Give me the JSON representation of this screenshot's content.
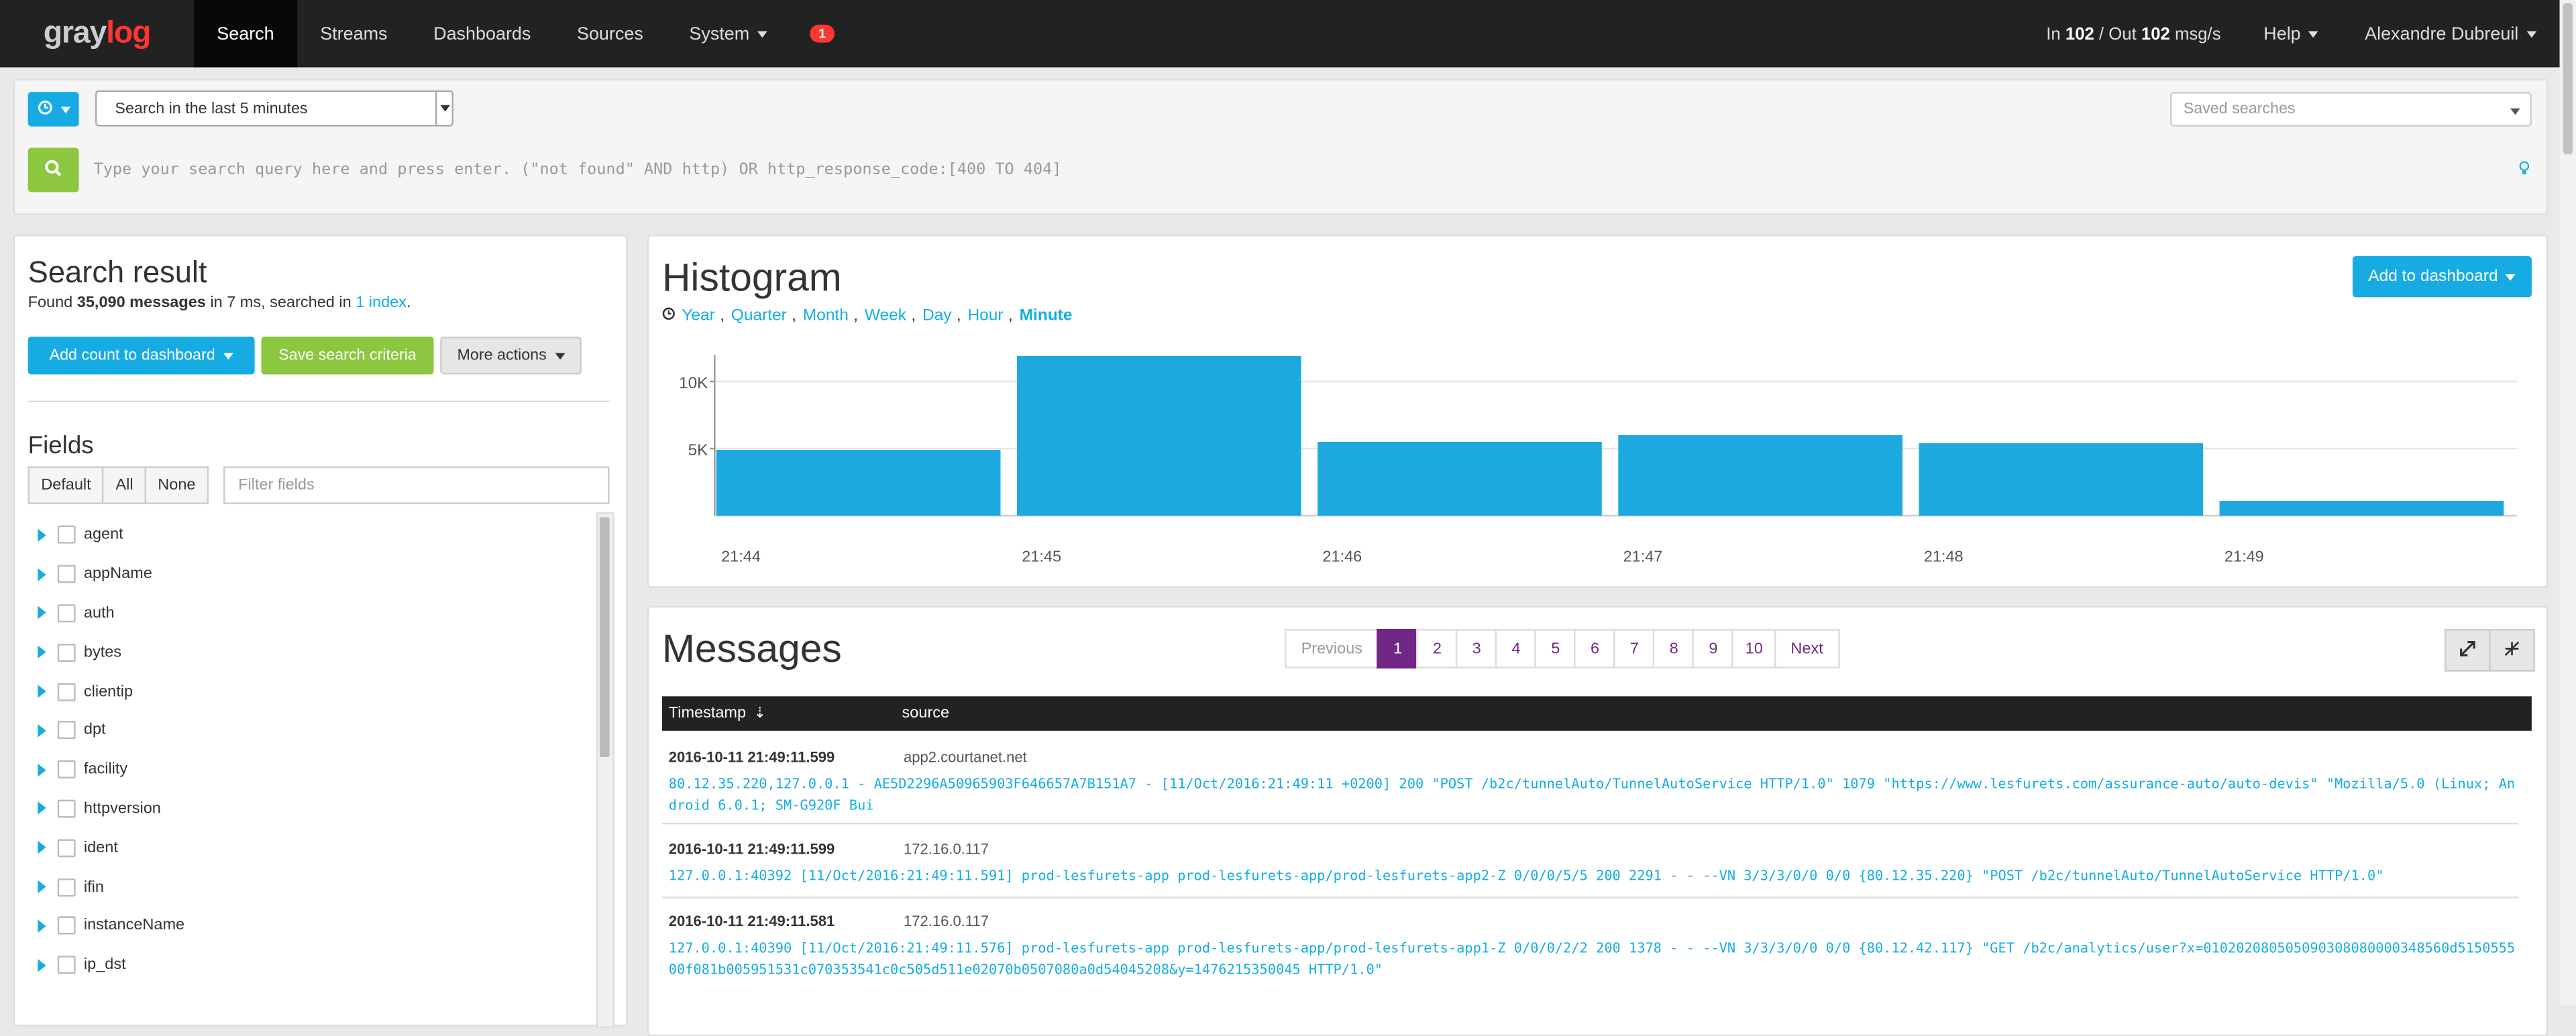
{
  "nav": {
    "logo_gray": "gray",
    "logo_log": "log",
    "items": [
      "Search",
      "Streams",
      "Dashboards",
      "Sources",
      "System"
    ],
    "notification_count": "1",
    "throughput_in_label": "In",
    "throughput_in": "102",
    "throughput_sep": "/ Out",
    "throughput_out": "102",
    "throughput_unit": "msg/s",
    "help": "Help",
    "user": "Alexandre Dubreuil"
  },
  "search": {
    "range": "Search in the last 5 minutes",
    "saved_searches_placeholder": "Saved searches",
    "query_placeholder": "Type your search query here and press enter. (\"not found\" AND http) OR http_response_code:[400 TO 404]"
  },
  "result": {
    "title": "Search result",
    "found_prefix": "Found",
    "count": "35,090 messages",
    "found_mid": "in 7 ms, searched in",
    "index_link": "1 index",
    "found_suffix": ".",
    "add_count_button": "Add count to dashboard",
    "save_criteria_button": "Save search criteria",
    "more_actions_button": "More actions",
    "fields_title": "Fields",
    "field_filters": [
      "Default",
      "All",
      "None"
    ],
    "filter_placeholder": "Filter fields",
    "fields": [
      "agent",
      "appName",
      "auth",
      "bytes",
      "clientip",
      "dpt",
      "facility",
      "httpversion",
      "ident",
      "ifin",
      "instanceName",
      "ip_dst"
    ]
  },
  "histogram": {
    "title": "Histogram",
    "resolutions": [
      "Year",
      "Quarter",
      "Month",
      "Week",
      "Day",
      "Hour",
      "Minute"
    ],
    "selected_resolution": "Minute",
    "add_to_dashboard": "Add to dashboard"
  },
  "chart_data": {
    "type": "bar",
    "categories": [
      "21:44",
      "21:45",
      "21:46",
      "21:47",
      "21:48",
      "21:49"
    ],
    "values": [
      4900,
      11900,
      5500,
      6000,
      5400,
      1100
    ],
    "yticks": [
      "5K",
      "10K"
    ],
    "ylim": [
      0,
      12000
    ],
    "color": "#1ea8e0",
    "grid": true
  },
  "messages": {
    "title": "Messages",
    "pager": {
      "previous": "Previous",
      "pages": [
        "1",
        "2",
        "3",
        "4",
        "5",
        "6",
        "7",
        "8",
        "9",
        "10"
      ],
      "active": "1",
      "next": "Next"
    },
    "columns": [
      "Timestamp",
      "source"
    ],
    "rows": [
      {
        "timestamp": "2016-10-11 21:49:11.599",
        "source": "app2.courtanet.net",
        "message": "80.12.35.220,127.0.0.1 - AE5D2296A50965903F646657A7B151A7 - [11/Oct/2016:21:49:11 +0200] 200 \"POST /b2c/tunnelAuto/TunnelAutoService HTTP/1.0\" 1079 \"https://www.lesfurets.com/assurance-auto/auto-devis\" \"Mozilla/5.0 (Linux; Android 6.0.1; SM-G920F Bui"
      },
      {
        "timestamp": "2016-10-11 21:49:11.599",
        "source": "172.16.0.117",
        "message": "127.0.0.1:40392 [11/Oct/2016:21:49:11.591] prod-lesfurets-app prod-lesfurets-app/prod-lesfurets-app2-Z 0/0/0/5/5 200 2291 - - --VN 3/3/3/0/0 0/0 {80.12.35.220} \"POST /b2c/tunnelAuto/TunnelAutoService HTTP/1.0\""
      },
      {
        "timestamp": "2016-10-11 21:49:11.581",
        "source": "172.16.0.117",
        "message": "127.0.0.1:40390 [11/Oct/2016:21:49:11.576] prod-lesfurets-app prod-lesfurets-app/prod-lesfurets-app1-Z 0/0/0/2/2 200 1378 - - --VN 3/3/3/0/0 0/0 {80.12.42.117} \"GET /b2c/analytics/user?x=010202080505090308080000348560d515055500f081b005951531c070353541c0c505d511e02070b0507080a0d54045208&y=1476215350045 HTTP/1.0\""
      }
    ]
  }
}
